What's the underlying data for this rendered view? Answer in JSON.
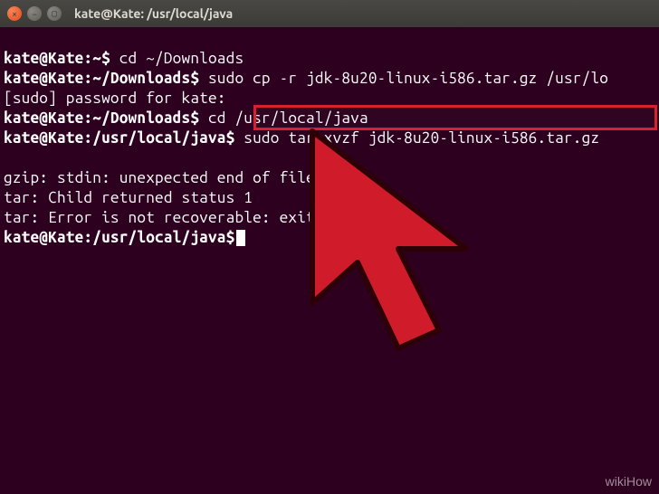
{
  "window": {
    "title": "kate@Kate: /usr/local/java"
  },
  "lines": {
    "l1_prompt": "kate@Kate:~$",
    "l1_cmd": " cd ~/Downloads",
    "l2_prompt": "kate@Kate:~/Downloads$",
    "l2_cmd": " sudo cp -r jdk-8u20-linux-i586.tar.gz /usr/lo",
    "l3": "[sudo] password for kate:",
    "l4_prompt": "kate@Kate:~/Downloads$",
    "l4_cmd": " cd /usr/local/java",
    "l5_prompt": "kate@Kate:/usr/local/java$",
    "l5_cmd": " sudo tar xvzf jdk-8u20-linux-i586.tar.gz",
    "blank": "",
    "l6": "gzip: stdin: unexpected end of file",
    "l7": "tar: Child returned status 1",
    "l8": "tar: Error is not recoverable: exiting now",
    "l9_prompt": "kate@Kate:/usr/local/java$"
  },
  "watermark": "wikiHow"
}
